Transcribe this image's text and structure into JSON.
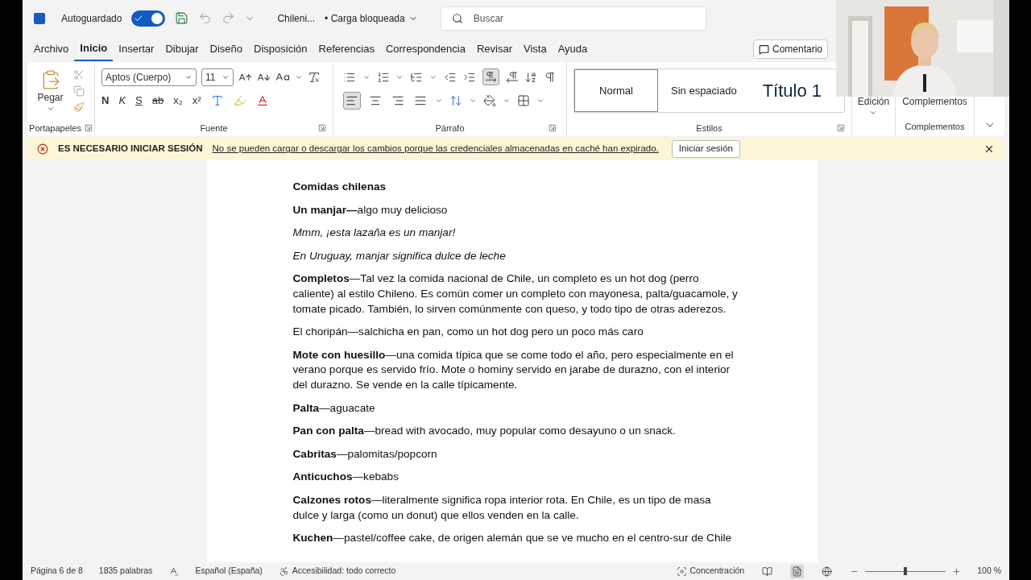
{
  "title_bar": {
    "autosave_label": "Autoguardado",
    "autosave_on": true,
    "doc_title": "Chileni...",
    "doc_status": "• Carga bloqueada",
    "search_placeholder": "Buscar"
  },
  "tabs": [
    {
      "label": "Archivo",
      "selected": false
    },
    {
      "label": "Inicio",
      "selected": true
    },
    {
      "label": "Insertar",
      "selected": false
    },
    {
      "label": "Dibujar",
      "selected": false
    },
    {
      "label": "Diseño",
      "selected": false
    },
    {
      "label": "Disposición",
      "selected": false
    },
    {
      "label": "Referencias",
      "selected": false
    },
    {
      "label": "Correspondencia",
      "selected": false
    },
    {
      "label": "Revisar",
      "selected": false
    },
    {
      "label": "Vista",
      "selected": false
    },
    {
      "label": "Ayuda",
      "selected": false
    }
  ],
  "comment_button": "Comentario",
  "ribbon": {
    "clipboard": {
      "paste_label": "Pegar",
      "group_label": "Portapapeles"
    },
    "font": {
      "font_name": "Aptos (Cuerpo)",
      "font_size": "11",
      "format_buttons": [
        "N",
        "K",
        "S",
        "ab",
        "x₂",
        "x²"
      ],
      "group_label": "Fuente"
    },
    "paragraph": {
      "ltr_selected": true,
      "alignments": [
        {
          "kind": "left",
          "selected": true
        },
        {
          "kind": "center",
          "selected": false
        },
        {
          "kind": "right",
          "selected": false
        },
        {
          "kind": "justify",
          "selected": false
        }
      ],
      "group_label": "Párrafo"
    },
    "styles": {
      "items": [
        {
          "label": "Normal",
          "kind": "body",
          "selected": true
        },
        {
          "label": "Sin espaciado",
          "kind": "body",
          "selected": false
        },
        {
          "label": "Título 1",
          "kind": "heading",
          "selected": false
        }
      ],
      "group_label": "Estilos"
    },
    "editing_label": "Edición",
    "addins_label": "Complementos",
    "addins_group_label": "Complementos"
  },
  "message_bar": {
    "title": "ES NECESARIO INICIAR SESIÓN",
    "message": "No se pueden cargar o descargar los cambios porque las credenciales almacenadas en caché han expirado.",
    "button": "Iniciar sesión"
  },
  "document": {
    "paragraphs": [
      {
        "kind": "heading",
        "text": "Comidas chilenas"
      },
      {
        "kind": "body",
        "text": "**Un manjar—**algo muy delicioso"
      },
      {
        "kind": "example",
        "text": "Mmm, ¡esta lazaña es un manjar!"
      },
      {
        "kind": "example",
        "text": "En Uruguay, manjar significa dulce de leche"
      },
      {
        "kind": "body",
        "text": "**Completos**—Tal vez la comida nacional de Chile, un completo es un hot dog (perro caliente) al estilo Chileno. Es común comer un completo con mayonesa, palta/guacamole, y tomate picado. También, lo sirven comúnmente con queso, y todo tipo de otras aderezos."
      },
      {
        "kind": "body",
        "text": "El choripán—salchicha en pan, como un hot dog pero un poco más caro"
      },
      {
        "kind": "body",
        "text": "**Mote con huesillo**—una comida típica que se come todo el año, pero especialmente en el verano porque es servido frío. Mote o hominy servido en jarabe de durazno, con el interior del durazno. Se vende en la calle típicamente."
      },
      {
        "kind": "body",
        "text": "**Palta**—aguacate"
      },
      {
        "kind": "body",
        "text": "**Pan con palta**—bread with avocado, muy popular como desayuno o un snack."
      },
      {
        "kind": "body",
        "text": "**Cabritas**—palomitas/popcorn"
      },
      {
        "kind": "body",
        "text": "**Anticuchos**—kebabs"
      },
      {
        "kind": "body",
        "text": "**Calzones rotos**—literalmente significa ropa interior rota. En Chile, es un tipo de masa dulce y larga (como un donut) que ellos venden en la calle."
      },
      {
        "kind": "body",
        "text": "**Kuchen**—pastel/coffee cake, de origen alemán que se ve mucho en el centro-sur de Chile"
      }
    ]
  },
  "status_bar": {
    "page": "Página 6 de 8",
    "words": "1835 palabras",
    "language": "Español (España)",
    "accessibility": "Accesibilidad: todo correcto",
    "focus": "Concentración",
    "views": [
      {
        "kind": "read",
        "selected": false
      },
      {
        "kind": "print",
        "selected": true
      },
      {
        "kind": "web",
        "selected": false
      }
    ],
    "zoom": {
      "level": 0.5
    },
    "zoom_label": "100 %"
  }
}
